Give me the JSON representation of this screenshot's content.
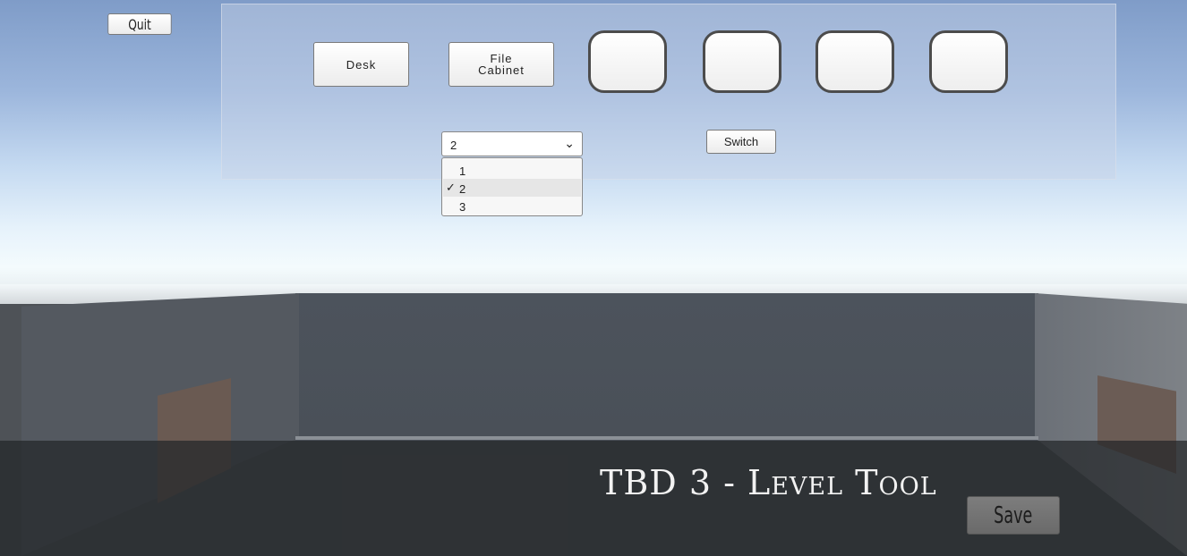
{
  "toolbar": {
    "quit_label": "Quit",
    "items": [
      {
        "label": "Desk"
      },
      {
        "label": "File\nCabinet"
      }
    ],
    "empty_slots": 4,
    "switch_label": "Switch"
  },
  "level_select": {
    "selected": "2",
    "options": [
      "1",
      "2",
      "3"
    ],
    "check_glyph": "✓",
    "chevron_icon": "chevron-down-icon"
  },
  "footer": {
    "title": "TBD 3 - Level Tool",
    "save_label": "Save"
  }
}
